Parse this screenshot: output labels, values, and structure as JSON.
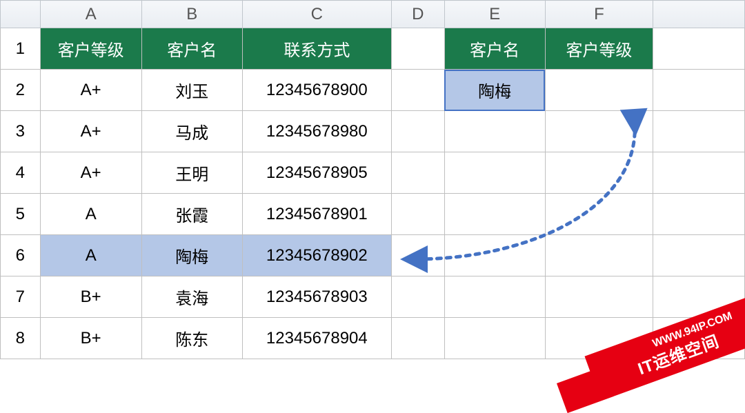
{
  "columns": [
    "A",
    "B",
    "C",
    "D",
    "E",
    "F"
  ],
  "row_labels": [
    "1",
    "2",
    "3",
    "4",
    "5",
    "6",
    "7",
    "8"
  ],
  "main_headers": {
    "A": "客户等级",
    "B": "客户名",
    "C": "联系方式"
  },
  "side_headers": {
    "E": "客户名",
    "F": "客户等级"
  },
  "rows": [
    {
      "level": "A+",
      "name": "刘玉",
      "contact": "12345678900"
    },
    {
      "level": "A+",
      "name": "马成",
      "contact": "12345678980"
    },
    {
      "level": "A+",
      "name": "王明",
      "contact": "12345678905"
    },
    {
      "level": "A",
      "name": "张霞",
      "contact": "12345678901"
    },
    {
      "level": "A",
      "name": "陶梅",
      "contact": "12345678902"
    },
    {
      "level": "B+",
      "name": "袁海",
      "contact": "12345678903"
    },
    {
      "level": "B+",
      "name": "陈东",
      "contact": "12345678904"
    }
  ],
  "lookup": {
    "name": "陶梅",
    "level": ""
  },
  "highlight_row_index": 4,
  "ribbon": {
    "url": "WWW.94IP.COM",
    "text": "IT运维空间"
  },
  "chart_data": {
    "type": "table",
    "title": "",
    "columns": [
      "客户等级",
      "客户名",
      "联系方式"
    ],
    "rows": [
      [
        "A+",
        "刘玉",
        "12345678900"
      ],
      [
        "A+",
        "马成",
        "12345678980"
      ],
      [
        "A+",
        "王明",
        "12345678905"
      ],
      [
        "A",
        "张霞",
        "12345678901"
      ],
      [
        "A",
        "陶梅",
        "12345678902"
      ],
      [
        "B+",
        "袁海",
        "12345678903"
      ],
      [
        "B+",
        "陈东",
        "12345678904"
      ]
    ],
    "lookup_table": {
      "columns": [
        "客户名",
        "客户等级"
      ],
      "rows": [
        [
          "陶梅",
          ""
        ]
      ]
    }
  }
}
